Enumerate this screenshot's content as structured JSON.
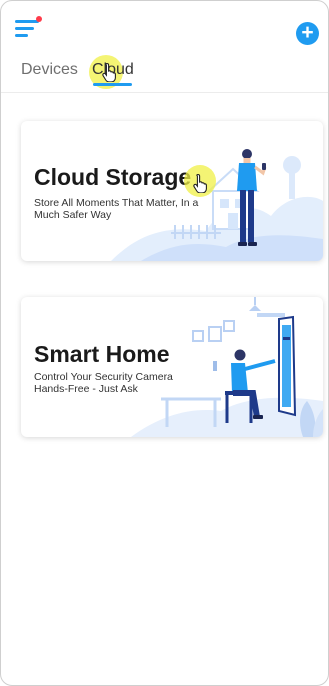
{
  "tabs": [
    {
      "label": "Devices",
      "selected": false
    },
    {
      "label": "Cloud",
      "selected": true
    }
  ],
  "cards": [
    {
      "title": "Cloud Storage",
      "subtitle_line1": "Store All Moments That Matter, In a",
      "subtitle_line2": "Much Safer Way"
    },
    {
      "title": "Smart Home",
      "subtitle_line1": "Control Your Security Camera",
      "subtitle_line2": "Hands-Free - Just Ask"
    }
  ],
  "colors": {
    "accent": "#1f9bf0",
    "notification_dot": "#ff3b4a",
    "illustration_light": "#dbe9fb"
  },
  "icons": {
    "menu": "hamburger-menu-icon",
    "add": "plus-circle-icon",
    "pointer": "hand-pointer-icon"
  }
}
